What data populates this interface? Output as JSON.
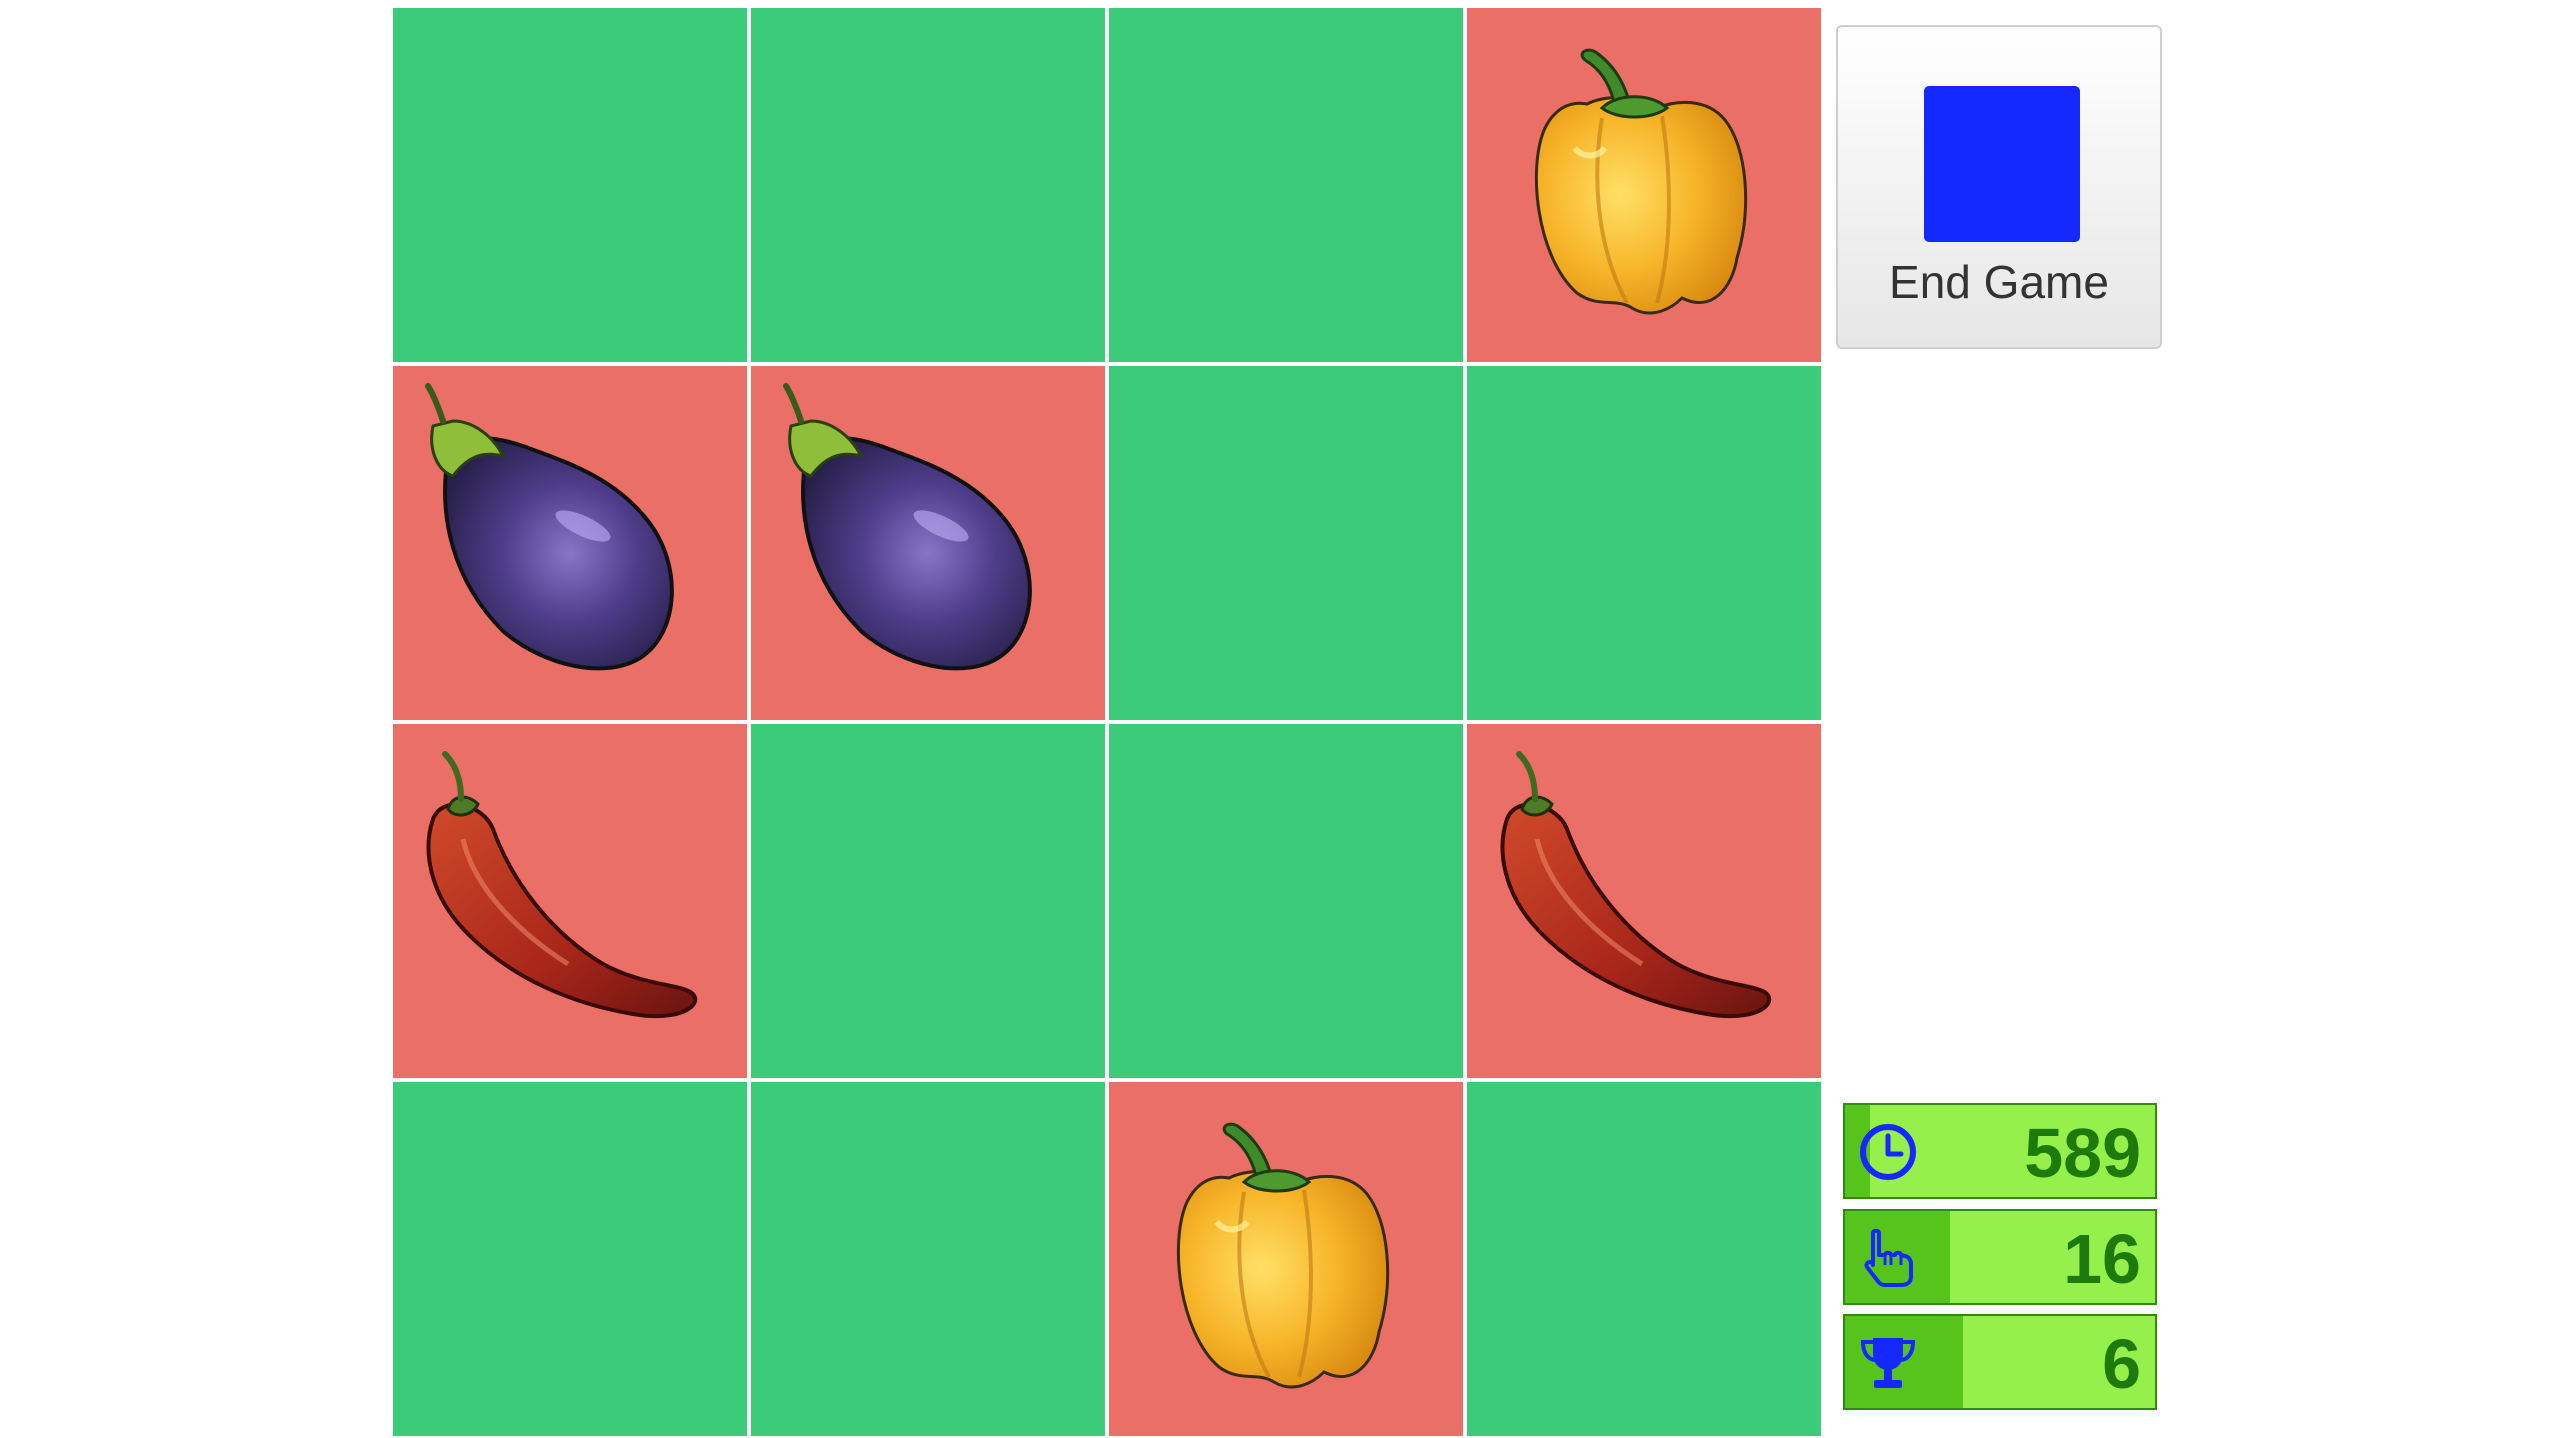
{
  "board": {
    "tiles": [
      {
        "state": "hidden",
        "veg": ""
      },
      {
        "state": "hidden",
        "veg": ""
      },
      {
        "state": "hidden",
        "veg": ""
      },
      {
        "state": "revealed",
        "veg": "bell-pepper"
      },
      {
        "state": "revealed",
        "veg": "eggplant"
      },
      {
        "state": "revealed",
        "veg": "eggplant"
      },
      {
        "state": "hidden",
        "veg": ""
      },
      {
        "state": "hidden",
        "veg": ""
      },
      {
        "state": "revealed",
        "veg": "chili-pepper"
      },
      {
        "state": "hidden",
        "veg": ""
      },
      {
        "state": "hidden",
        "veg": ""
      },
      {
        "state": "revealed",
        "veg": "chili-pepper"
      },
      {
        "state": "hidden",
        "veg": ""
      },
      {
        "state": "hidden",
        "veg": ""
      },
      {
        "state": "revealed",
        "veg": "bell-pepper"
      },
      {
        "state": "hidden",
        "veg": ""
      }
    ]
  },
  "controls": {
    "end_game_label": "End Game",
    "swatch_color": "#1428ff"
  },
  "stats": {
    "timer": {
      "value": "589",
      "icon": "clock-icon",
      "level": 0.08
    },
    "moves": {
      "value": "16",
      "icon": "pointing-hand-icon",
      "level": 0.34
    },
    "matches": {
      "value": "6",
      "icon": "trophy-icon",
      "level": 0.38
    }
  },
  "colors": {
    "tile_hidden": "#3ccb78",
    "tile_revealed": "#ea6f67",
    "stat_bg": "#95f04c",
    "stat_fill": "#57c41e",
    "stat_text": "#1d7a0b",
    "icon": "#1428ff"
  }
}
